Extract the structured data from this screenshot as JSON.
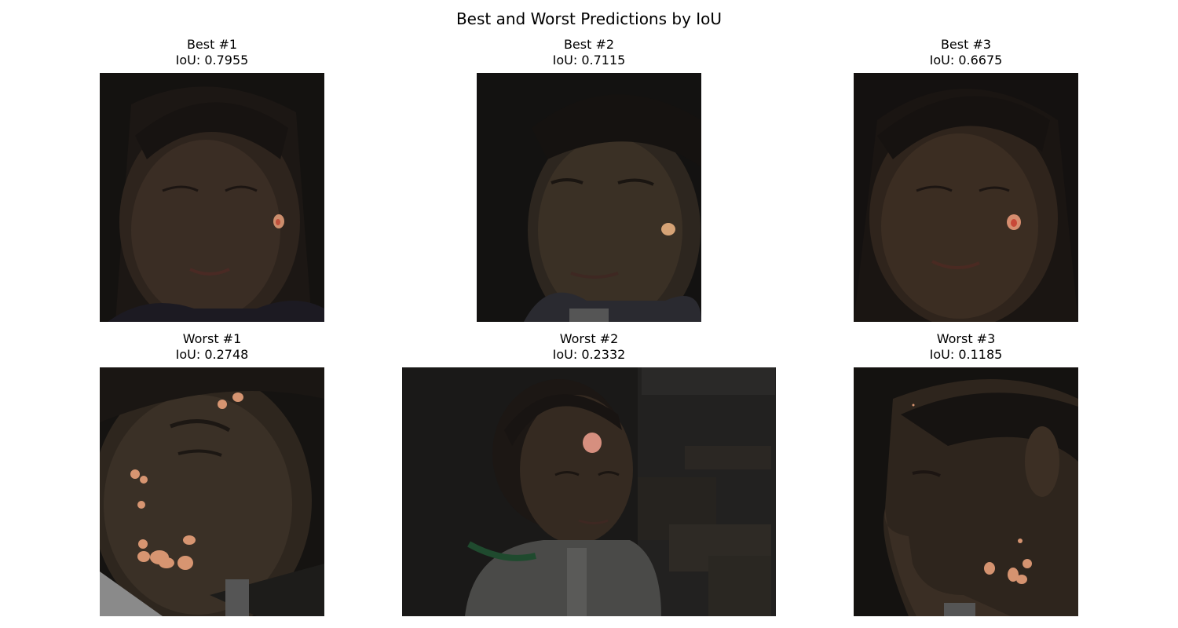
{
  "figure": {
    "title": "Best and Worst Predictions by IoU"
  },
  "panels": [
    {
      "label": "Best #1",
      "iou": "IoU: 0.7955",
      "image": "face-photo-with-lesion-overlay"
    },
    {
      "label": "Best #2",
      "iou": "IoU: 0.7115",
      "image": "face-photo-with-lesion-overlay"
    },
    {
      "label": "Best #3",
      "iou": "IoU: 0.6675",
      "image": "face-photo-with-lesion-overlay"
    },
    {
      "label": "Worst #1",
      "iou": "IoU: 0.2748",
      "image": "face-photo-with-lesion-overlay"
    },
    {
      "label": "Worst #2",
      "iou": "IoU: 0.2332",
      "image": "face-photo-with-lesion-overlay"
    },
    {
      "label": "Worst #3",
      "iou": "IoU: 0.1185",
      "image": "face-photo-with-lesion-overlay"
    }
  ],
  "colors": {
    "background": "#151311",
    "skin_shadow": "#2a211b",
    "skin_mid": "#3b2d23",
    "lesion_mask": "#e8a07a",
    "lesion_core": "#d06048"
  }
}
